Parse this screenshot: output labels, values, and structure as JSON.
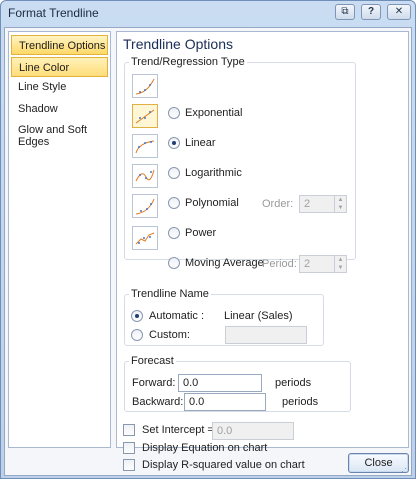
{
  "window": {
    "title": "Format Trendline"
  },
  "title_buttons": {
    "restore": "⧉",
    "help": "?",
    "close": "✕"
  },
  "nav": {
    "items": [
      {
        "label": "Trendline Options"
      },
      {
        "label": "Line Color"
      },
      {
        "label": "Line Style"
      },
      {
        "label": "Shadow"
      },
      {
        "label": "Glow and Soft Edges"
      }
    ]
  },
  "panel": {
    "heading": "Trendline Options",
    "regression_group": "Trend/Regression Type",
    "types": [
      {
        "label": "Exponential",
        "accel": "x",
        "selected": false
      },
      {
        "label": "Linear",
        "accel": "i",
        "selected": true
      },
      {
        "label": "Logarithmic",
        "accel": "o",
        "selected": false
      },
      {
        "label": "Polynomial",
        "accel": "P",
        "selected": false
      },
      {
        "label": "Power",
        "accel": "w",
        "selected": false
      },
      {
        "label": "Moving Average",
        "accel": "M",
        "selected": false
      }
    ],
    "order_label": "Order:",
    "order_value": "2",
    "period_label": "Period:",
    "period_value": "2",
    "name_group": "Trendline Name",
    "automatic_label": "Automatic :",
    "automatic_value": "Linear (Sales)",
    "custom_label": "Custom:",
    "custom_value": "",
    "forecast_group": "Forecast",
    "forward_label": "Forward:",
    "forward_value": "0.0",
    "forward_unit": "periods",
    "backward_label": "Backward:",
    "backward_value": "0.0",
    "backward_unit": "periods",
    "intercept_label": "Set Intercept =",
    "intercept_value": "0.0",
    "equation_label": "Display Equation on chart",
    "rsquared_label": "Display R-squared value on chart"
  },
  "footer": {
    "close_label": "Close"
  },
  "colors": {
    "accent": "#ffd867",
    "titlebar": "#c9dcf2"
  }
}
